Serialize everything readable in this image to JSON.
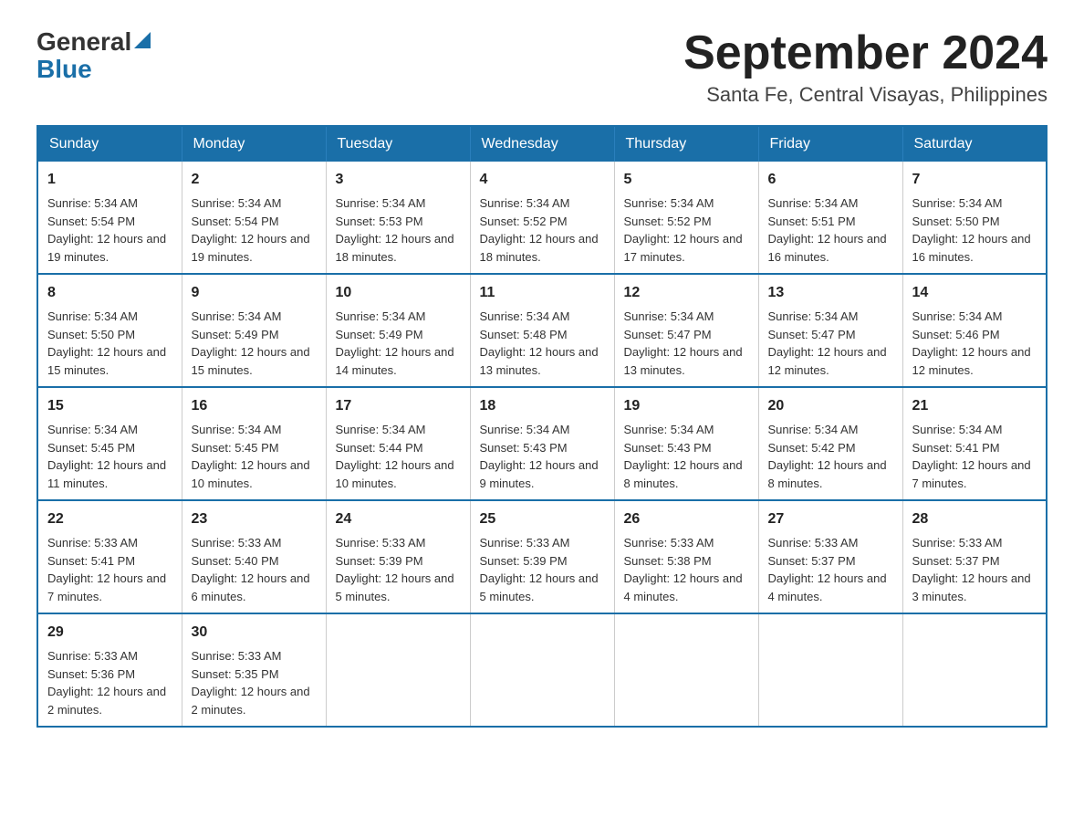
{
  "logo": {
    "general": "General",
    "blue": "Blue",
    "triangle_alt": "blue triangle arrow"
  },
  "title": "September 2024",
  "subtitle": "Santa Fe, Central Visayas, Philippines",
  "weekdays": [
    "Sunday",
    "Monday",
    "Tuesday",
    "Wednesday",
    "Thursday",
    "Friday",
    "Saturday"
  ],
  "weeks": [
    [
      {
        "day": "1",
        "sunrise": "Sunrise: 5:34 AM",
        "sunset": "Sunset: 5:54 PM",
        "daylight": "Daylight: 12 hours and 19 minutes."
      },
      {
        "day": "2",
        "sunrise": "Sunrise: 5:34 AM",
        "sunset": "Sunset: 5:54 PM",
        "daylight": "Daylight: 12 hours and 19 minutes."
      },
      {
        "day": "3",
        "sunrise": "Sunrise: 5:34 AM",
        "sunset": "Sunset: 5:53 PM",
        "daylight": "Daylight: 12 hours and 18 minutes."
      },
      {
        "day": "4",
        "sunrise": "Sunrise: 5:34 AM",
        "sunset": "Sunset: 5:52 PM",
        "daylight": "Daylight: 12 hours and 18 minutes."
      },
      {
        "day": "5",
        "sunrise": "Sunrise: 5:34 AM",
        "sunset": "Sunset: 5:52 PM",
        "daylight": "Daylight: 12 hours and 17 minutes."
      },
      {
        "day": "6",
        "sunrise": "Sunrise: 5:34 AM",
        "sunset": "Sunset: 5:51 PM",
        "daylight": "Daylight: 12 hours and 16 minutes."
      },
      {
        "day": "7",
        "sunrise": "Sunrise: 5:34 AM",
        "sunset": "Sunset: 5:50 PM",
        "daylight": "Daylight: 12 hours and 16 minutes."
      }
    ],
    [
      {
        "day": "8",
        "sunrise": "Sunrise: 5:34 AM",
        "sunset": "Sunset: 5:50 PM",
        "daylight": "Daylight: 12 hours and 15 minutes."
      },
      {
        "day": "9",
        "sunrise": "Sunrise: 5:34 AM",
        "sunset": "Sunset: 5:49 PM",
        "daylight": "Daylight: 12 hours and 15 minutes."
      },
      {
        "day": "10",
        "sunrise": "Sunrise: 5:34 AM",
        "sunset": "Sunset: 5:49 PM",
        "daylight": "Daylight: 12 hours and 14 minutes."
      },
      {
        "day": "11",
        "sunrise": "Sunrise: 5:34 AM",
        "sunset": "Sunset: 5:48 PM",
        "daylight": "Daylight: 12 hours and 13 minutes."
      },
      {
        "day": "12",
        "sunrise": "Sunrise: 5:34 AM",
        "sunset": "Sunset: 5:47 PM",
        "daylight": "Daylight: 12 hours and 13 minutes."
      },
      {
        "day": "13",
        "sunrise": "Sunrise: 5:34 AM",
        "sunset": "Sunset: 5:47 PM",
        "daylight": "Daylight: 12 hours and 12 minutes."
      },
      {
        "day": "14",
        "sunrise": "Sunrise: 5:34 AM",
        "sunset": "Sunset: 5:46 PM",
        "daylight": "Daylight: 12 hours and 12 minutes."
      }
    ],
    [
      {
        "day": "15",
        "sunrise": "Sunrise: 5:34 AM",
        "sunset": "Sunset: 5:45 PM",
        "daylight": "Daylight: 12 hours and 11 minutes."
      },
      {
        "day": "16",
        "sunrise": "Sunrise: 5:34 AM",
        "sunset": "Sunset: 5:45 PM",
        "daylight": "Daylight: 12 hours and 10 minutes."
      },
      {
        "day": "17",
        "sunrise": "Sunrise: 5:34 AM",
        "sunset": "Sunset: 5:44 PM",
        "daylight": "Daylight: 12 hours and 10 minutes."
      },
      {
        "day": "18",
        "sunrise": "Sunrise: 5:34 AM",
        "sunset": "Sunset: 5:43 PM",
        "daylight": "Daylight: 12 hours and 9 minutes."
      },
      {
        "day": "19",
        "sunrise": "Sunrise: 5:34 AM",
        "sunset": "Sunset: 5:43 PM",
        "daylight": "Daylight: 12 hours and 8 minutes."
      },
      {
        "day": "20",
        "sunrise": "Sunrise: 5:34 AM",
        "sunset": "Sunset: 5:42 PM",
        "daylight": "Daylight: 12 hours and 8 minutes."
      },
      {
        "day": "21",
        "sunrise": "Sunrise: 5:34 AM",
        "sunset": "Sunset: 5:41 PM",
        "daylight": "Daylight: 12 hours and 7 minutes."
      }
    ],
    [
      {
        "day": "22",
        "sunrise": "Sunrise: 5:33 AM",
        "sunset": "Sunset: 5:41 PM",
        "daylight": "Daylight: 12 hours and 7 minutes."
      },
      {
        "day": "23",
        "sunrise": "Sunrise: 5:33 AM",
        "sunset": "Sunset: 5:40 PM",
        "daylight": "Daylight: 12 hours and 6 minutes."
      },
      {
        "day": "24",
        "sunrise": "Sunrise: 5:33 AM",
        "sunset": "Sunset: 5:39 PM",
        "daylight": "Daylight: 12 hours and 5 minutes."
      },
      {
        "day": "25",
        "sunrise": "Sunrise: 5:33 AM",
        "sunset": "Sunset: 5:39 PM",
        "daylight": "Daylight: 12 hours and 5 minutes."
      },
      {
        "day": "26",
        "sunrise": "Sunrise: 5:33 AM",
        "sunset": "Sunset: 5:38 PM",
        "daylight": "Daylight: 12 hours and 4 minutes."
      },
      {
        "day": "27",
        "sunrise": "Sunrise: 5:33 AM",
        "sunset": "Sunset: 5:37 PM",
        "daylight": "Daylight: 12 hours and 4 minutes."
      },
      {
        "day": "28",
        "sunrise": "Sunrise: 5:33 AM",
        "sunset": "Sunset: 5:37 PM",
        "daylight": "Daylight: 12 hours and 3 minutes."
      }
    ],
    [
      {
        "day": "29",
        "sunrise": "Sunrise: 5:33 AM",
        "sunset": "Sunset: 5:36 PM",
        "daylight": "Daylight: 12 hours and 2 minutes."
      },
      {
        "day": "30",
        "sunrise": "Sunrise: 5:33 AM",
        "sunset": "Sunset: 5:35 PM",
        "daylight": "Daylight: 12 hours and 2 minutes."
      },
      null,
      null,
      null,
      null,
      null
    ]
  ]
}
